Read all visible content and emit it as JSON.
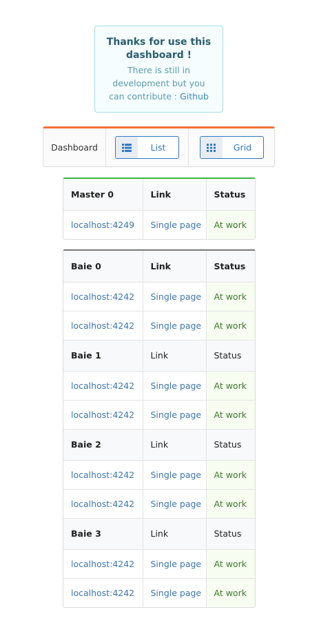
{
  "notice": {
    "title": "Thanks for use this dashboard !",
    "body_line1": "There is still in",
    "body_line2": "development but you",
    "body_line3": "can contribute : ",
    "link_label": "Github"
  },
  "toolbar": {
    "title": "Dashboard",
    "list_button": "List",
    "grid_button": "Grid",
    "accent_color": "#f36f34"
  },
  "master": {
    "accent_color": "#3cb54a",
    "header": [
      "Master 0",
      "Link",
      "Status"
    ],
    "rows": [
      {
        "host": "localhost:4249",
        "link": "Single page",
        "status": "At work"
      }
    ]
  },
  "baies": {
    "accent_color": "#777777",
    "groups": [
      {
        "header": [
          "Baie 0",
          "Link",
          "Status"
        ],
        "rows": [
          {
            "host": "localhost:4242",
            "link": "Single page",
            "status": "At work"
          },
          {
            "host": "localhost:4242",
            "link": "Single page",
            "status": "At work"
          }
        ]
      },
      {
        "header": [
          "Baie 1",
          "Link",
          "Status"
        ],
        "rows": [
          {
            "host": "localhost:4242",
            "link": "Single page",
            "status": "At work"
          },
          {
            "host": "localhost:4242",
            "link": "Single page",
            "status": "At work"
          }
        ]
      },
      {
        "header": [
          "Baie 2",
          "Link",
          "Status"
        ],
        "rows": [
          {
            "host": "localhost:4242",
            "link": "Single page",
            "status": "At work"
          },
          {
            "host": "localhost:4242",
            "link": "Single page",
            "status": "At work"
          }
        ]
      },
      {
        "header": [
          "Baie 3",
          "Link",
          "Status"
        ],
        "rows": [
          {
            "host": "localhost:4242",
            "link": "Single page",
            "status": "At work"
          },
          {
            "host": "localhost:4242",
            "link": "Single page",
            "status": "At work"
          }
        ]
      }
    ]
  }
}
